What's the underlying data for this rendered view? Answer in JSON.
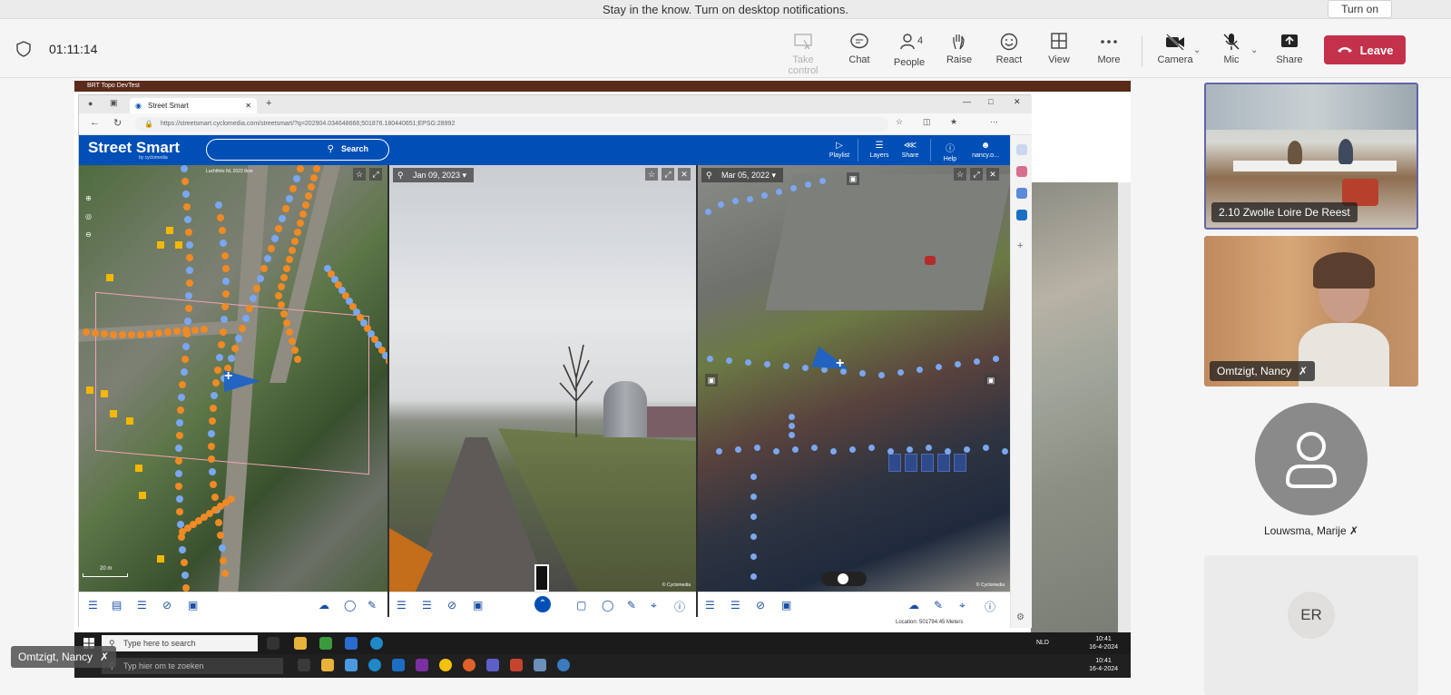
{
  "banner": {
    "text": "Stay in the know. Turn on desktop notifications.",
    "button": "Turn on"
  },
  "meeting": {
    "timer": "01:11:14",
    "toolbar": {
      "take_control": "Take control",
      "chat": "Chat",
      "people": "People",
      "people_count": "4",
      "raise": "Raise",
      "react": "React",
      "view": "View",
      "more": "More",
      "camera": "Camera",
      "mic": "Mic",
      "share": "Share",
      "leave": "Leave"
    }
  },
  "shared_screen": {
    "behind_app_title": "BRT Topo DevTest",
    "browser": {
      "tab_title": "Street Smart",
      "url": "https://streetsmart.cyclomedia.com/streetsmart/?q=202904.034648666;501876.180440651;EPSG:28992"
    },
    "streetsmart": {
      "logo": "Street Smart",
      "logo_sub": "by cyclomedia",
      "search_label": "Search",
      "header_items": [
        "Playlist",
        "Layers",
        "Share",
        "Help",
        "nancy.o..."
      ],
      "pane1": {
        "layer_label": "Luchtfoto NL 2023 8cm",
        "scale": "20 m"
      },
      "pane2": {
        "date": "Jan 09, 2023",
        "badge": "© Cyclomedia"
      },
      "pane3": {
        "date": "Mar 05, 2022",
        "badge": "© Cyclomedia"
      },
      "footer_coords": "Location: 501794.45 Meters"
    },
    "taskbar_top": {
      "search_placeholder": "Type here to search",
      "lang": "NLD",
      "time": "10:41",
      "date": "16-4-2024"
    },
    "taskbar_bottom": {
      "search_placeholder": "Typ hier om te zoeken",
      "time": "10:41",
      "date": "16-4-2024"
    }
  },
  "participants": [
    {
      "name": "2.10 Zwolle Loire De Reest"
    },
    {
      "name": "Omtzigt, Nancy"
    },
    {
      "name": "Louwsma, Marije"
    },
    {
      "initials": "ER"
    }
  ],
  "self_view": {
    "name": "Omtzigt, Nancy"
  },
  "colors": {
    "accent": "#6264a7",
    "leave": "#c4314b",
    "streetsmart_blue": "#004fb6",
    "cycle_dot_orange": "#f08a24",
    "cycle_dot_blue": "#7aa7f0"
  }
}
